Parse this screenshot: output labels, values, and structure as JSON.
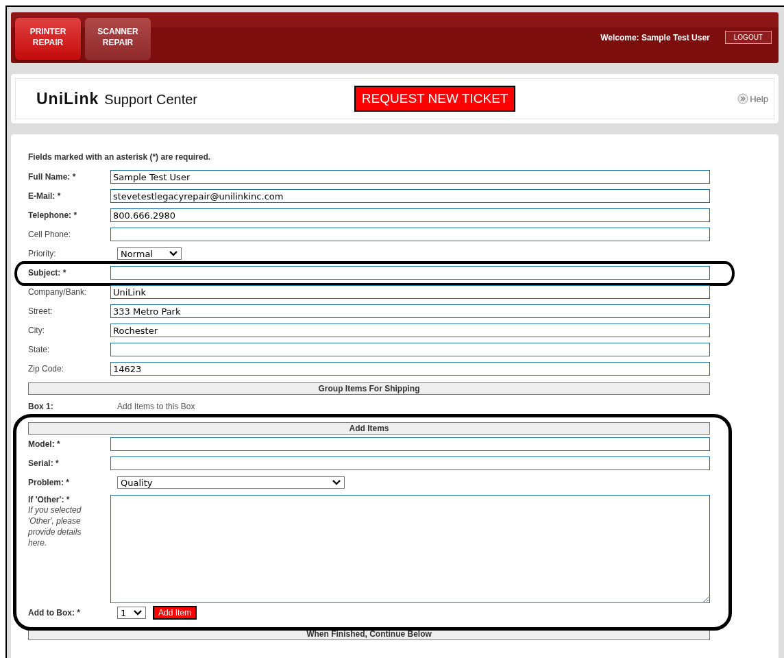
{
  "header": {
    "tabs": [
      {
        "label": "PRINTER\nREPAIR",
        "selected": true
      },
      {
        "label": "SCANNER\nREPAIR",
        "selected": false
      }
    ],
    "welcome": "Welcome: Sample Test User",
    "logout": "LOGOUT"
  },
  "brand": {
    "logo": "UniLink",
    "title": "Support Center",
    "request_button": "REQUEST NEW TICKET",
    "help": "Help"
  },
  "form": {
    "note": "Fields marked with an asterisk (*) are required.",
    "fields": [
      {
        "kind": "text",
        "label": "Full Name: *",
        "required": true,
        "value": "Sample Test User",
        "circled": false
      },
      {
        "kind": "text",
        "label": "E-Mail: *",
        "required": true,
        "value": "stevetestlegacyrepair@unilinkinc.com",
        "circled": false
      },
      {
        "kind": "text",
        "label": "Telephone: *",
        "required": true,
        "value": "800.666.2980",
        "circled": false
      },
      {
        "kind": "text",
        "label": "Cell Phone:",
        "required": false,
        "circled": false
      },
      {
        "kind": "select",
        "label": "Priority:",
        "required": false,
        "value": "Normal",
        "circled": false
      },
      {
        "kind": "text",
        "label": "Subject: *",
        "required": true,
        "circled": true
      },
      {
        "kind": "text",
        "label": "Company/Bank:",
        "required": false,
        "value": "UniLink",
        "circled": false
      },
      {
        "kind": "text",
        "label": "Street:",
        "required": false,
        "value": "333 Metro Park",
        "circled": false
      },
      {
        "kind": "text",
        "label": "City:",
        "required": false,
        "value": "Rochester",
        "circled": false
      },
      {
        "kind": "text",
        "label": "State:",
        "required": false,
        "circled": false
      },
      {
        "kind": "text",
        "label": "Zip Code:",
        "required": false,
        "value": "14623",
        "circled": false
      }
    ],
    "group_bar": "Group Items For Shipping",
    "box_label": "Box 1:",
    "box_hint": "Add Items to this Box",
    "add_items": {
      "circled": true,
      "bar": "Add Items",
      "fields": [
        {
          "kind": "text",
          "label": "Model: *"
        },
        {
          "kind": "text",
          "label": "Serial: *"
        },
        {
          "kind": "select",
          "label": "Problem: *",
          "value": "Quality"
        },
        {
          "kind": "textarea",
          "label": "If 'Other': *",
          "hint": "If you selected 'Other', please provide details here."
        }
      ],
      "add_to_box_label": "Add to Box: *",
      "box_select": "1",
      "add_button": "Add Item"
    },
    "finish_bar": "When Finished, Continue Below"
  }
}
